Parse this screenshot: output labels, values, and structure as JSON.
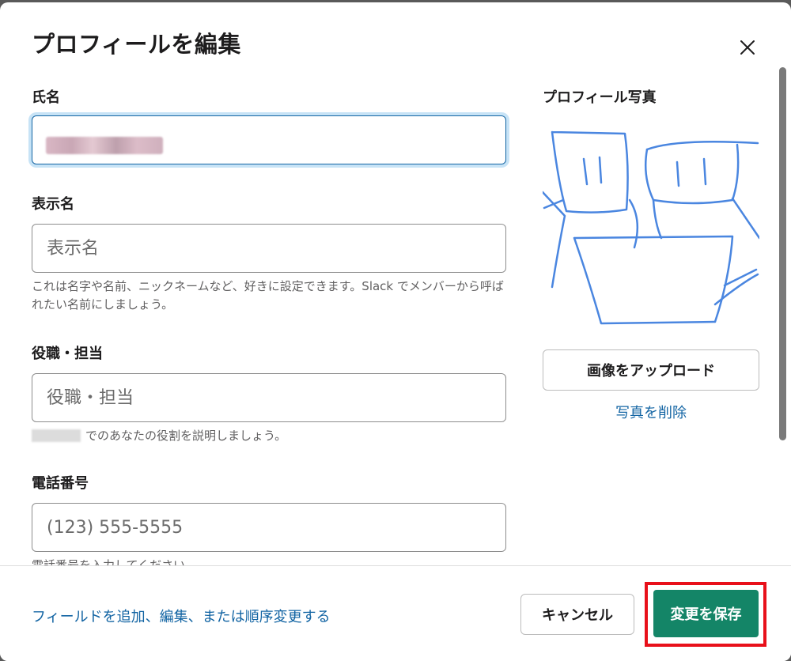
{
  "modal": {
    "title": "プロフィールを編集",
    "close_icon": "close-icon"
  },
  "fields": {
    "full_name": {
      "label": "氏名",
      "value": ""
    },
    "display_name": {
      "label": "表示名",
      "placeholder": "表示名",
      "help": "これは名字や名前、ニックネームなど、好きに設定できます。Slack でメンバーから呼ばれたい名前にしましょう。"
    },
    "title": {
      "label": "役職・担当",
      "placeholder": "役職・担当",
      "help": "でのあなたの役割を説明しましょう。"
    },
    "phone": {
      "label": "電話番号",
      "placeholder": "(123) 555-5555",
      "help": "電話番号を入力してください"
    }
  },
  "photo": {
    "title": "プロフィール写真",
    "upload_label": "画像をアップロード",
    "delete_label": "写真を削除"
  },
  "footer": {
    "add_fields_link": "フィールドを追加、編集、または順序変更する",
    "cancel_label": "キャンセル",
    "save_label": "変更を保存"
  },
  "colors": {
    "accent_blue": "#1264a3",
    "save_green": "#148567",
    "highlight_red": "#e8101a",
    "sketch_blue": "#4a86e0"
  }
}
